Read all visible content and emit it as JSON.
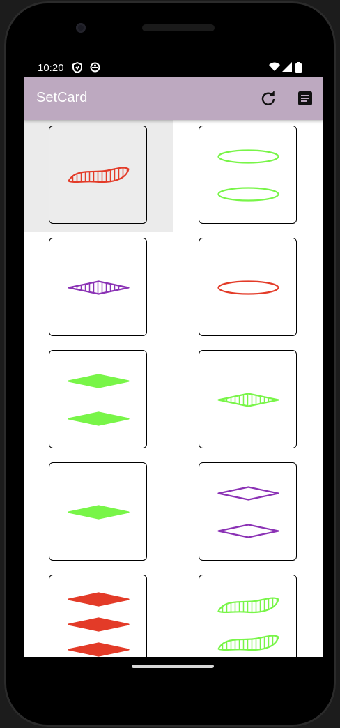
{
  "status_bar": {
    "time": "10:20",
    "icons": [
      "shield-icon",
      "app-notification-icon",
      "wifi-icon",
      "signal-icon",
      "battery-icon"
    ]
  },
  "app_bar": {
    "title": "SetCard",
    "actions": [
      "refresh-icon",
      "notes-icon"
    ]
  },
  "colors": {
    "app_bar": "#bda9c0",
    "red": "#e33b28",
    "green": "#78f548",
    "purple": "#8b32b5"
  },
  "cards": [
    {
      "shape": "squiggle",
      "color": "red",
      "shading": "striped",
      "count": 1,
      "selected": true
    },
    {
      "shape": "oval",
      "color": "green",
      "shading": "open",
      "count": 2,
      "selected": false
    },
    {
      "shape": "diamond",
      "color": "purple",
      "shading": "striped",
      "count": 1,
      "selected": false
    },
    {
      "shape": "oval",
      "color": "red",
      "shading": "open",
      "count": 1,
      "selected": false
    },
    {
      "shape": "diamond",
      "color": "green",
      "shading": "solid",
      "count": 2,
      "selected": false
    },
    {
      "shape": "diamond",
      "color": "green",
      "shading": "striped",
      "count": 1,
      "selected": false
    },
    {
      "shape": "diamond",
      "color": "green",
      "shading": "solid",
      "count": 1,
      "selected": false
    },
    {
      "shape": "diamond",
      "color": "purple",
      "shading": "open",
      "count": 2,
      "selected": false
    },
    {
      "shape": "diamond",
      "color": "red",
      "shading": "solid",
      "count": 3,
      "selected": false
    },
    {
      "shape": "squiggle",
      "color": "green",
      "shading": "striped",
      "count": 2,
      "selected": false
    }
  ]
}
